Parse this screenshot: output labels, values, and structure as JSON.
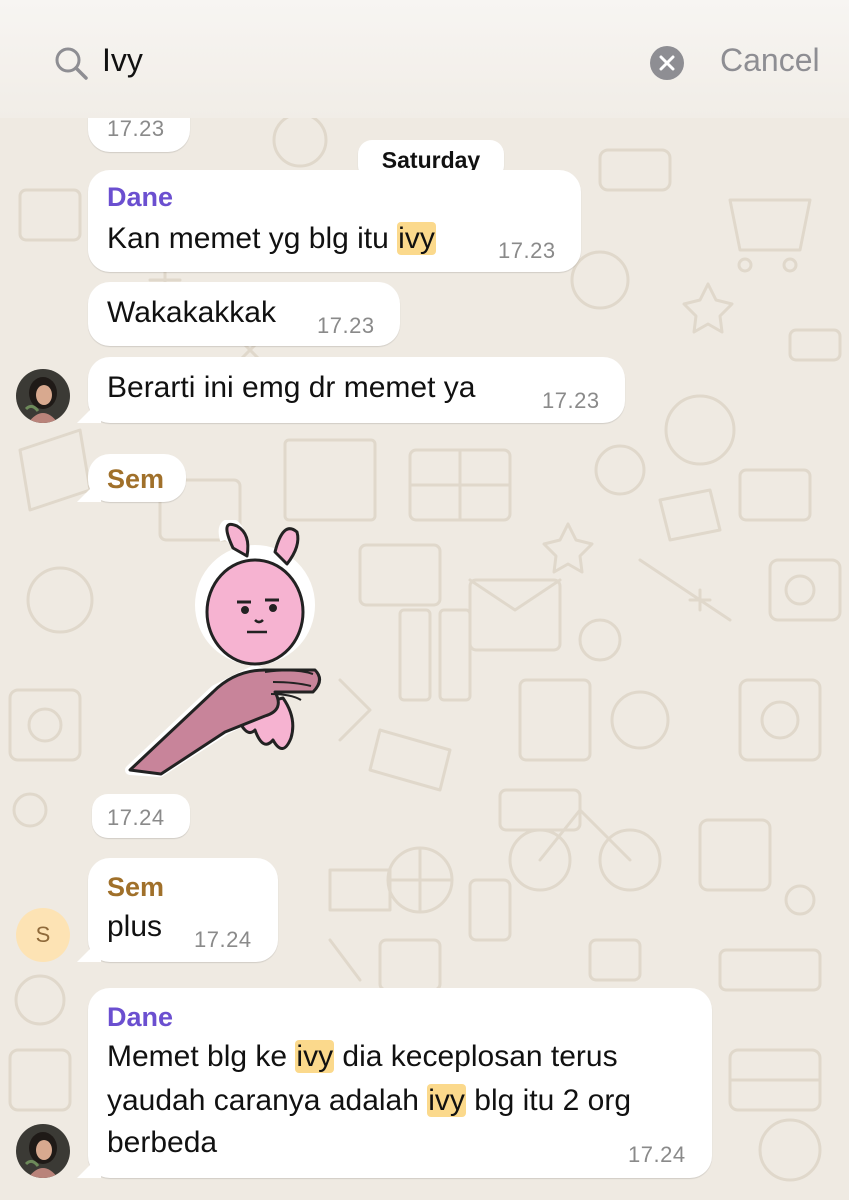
{
  "search": {
    "query": "Ivy",
    "cancel_label": "Cancel"
  },
  "chat": {
    "top_partial_time": "17.23",
    "day_separator": "Saturday",
    "messages": [
      {
        "sender": "Dane",
        "parts": [
          "Kan memet yg blg itu ",
          "ivy"
        ],
        "time": "17.23"
      },
      {
        "text": "Wakakakkak",
        "time": "17.23"
      },
      {
        "text": "Berarti ini emg dr memet ya",
        "time": "17.23"
      },
      {
        "sender": "Sem",
        "type": "sticker",
        "sticker": "pink-bunny-sticker",
        "time": "17.24"
      },
      {
        "sender": "Sem",
        "text": "plus",
        "time": "17.24",
        "avatar_letter": "S"
      },
      {
        "sender": "Dane",
        "lines": [
          [
            "Memet blg ke ",
            "ivy",
            " dia keceplosan terus"
          ],
          [
            "yaudah caranya adalah ",
            "ivy",
            " blg itu 2 org"
          ],
          [
            "berbeda"
          ]
        ],
        "time": "17.24"
      }
    ]
  },
  "colors": {
    "background": "#efeae2",
    "dane_name": "#6b4fd0",
    "sem_name": "#a0702a",
    "highlight": "#fbd98c",
    "timestamp": "#8a8a8a"
  },
  "icons": [
    "search-icon",
    "clear-icon",
    "avatar-photo",
    "pink-bunny-sticker"
  ]
}
